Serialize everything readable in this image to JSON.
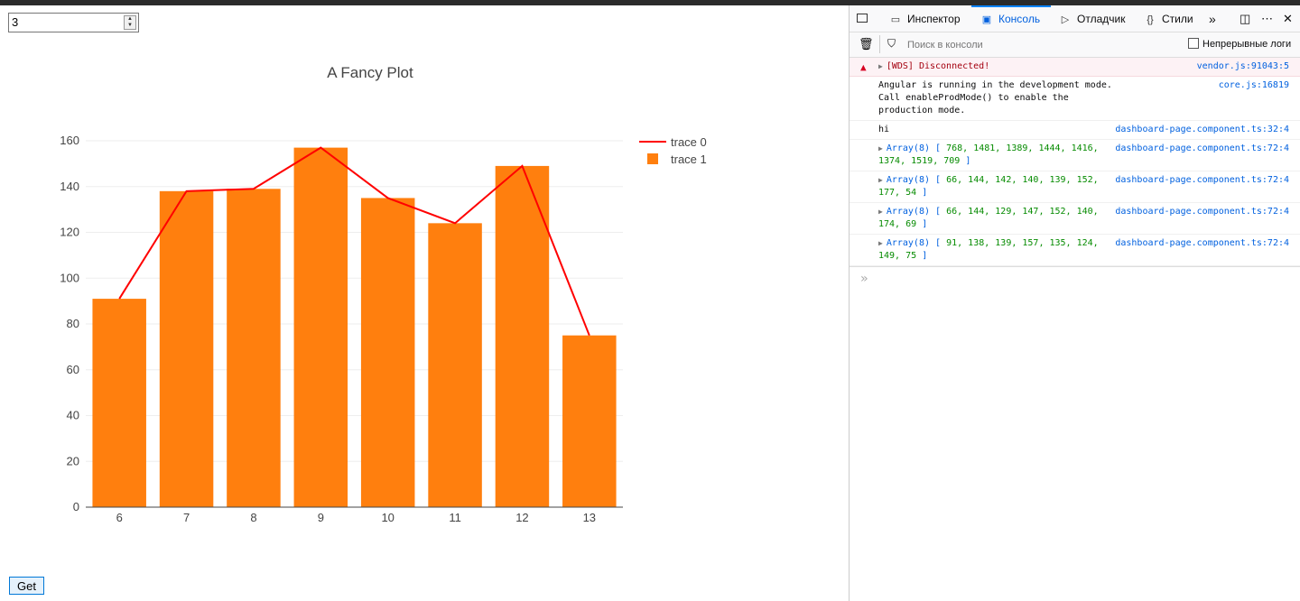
{
  "page": {
    "number_input_value": "3",
    "get_button_label": "Get"
  },
  "chart_data": {
    "type": "bar",
    "title": "A Fancy Plot",
    "x": [
      6,
      7,
      8,
      9,
      10,
      11,
      12,
      13
    ],
    "x_tick_labels": [
      "6",
      "7",
      "8",
      "9",
      "10",
      "11",
      "12",
      "13"
    ],
    "y_tick_labels": [
      "0",
      "20",
      "40",
      "60",
      "80",
      "100",
      "120",
      "140",
      "160"
    ],
    "ylim": [
      0,
      160
    ],
    "grid": true,
    "legend_position": "top-right",
    "series": [
      {
        "name": "trace 0",
        "type": "line",
        "color": "#ff0000",
        "values": [
          91,
          138,
          139,
          157,
          135,
          124,
          149,
          75
        ]
      },
      {
        "name": "trace 1",
        "type": "bar",
        "color": "#ff7f0e",
        "values": [
          91,
          138,
          139,
          157,
          135,
          124,
          149,
          75
        ]
      }
    ]
  },
  "devtools": {
    "tabs": [
      {
        "label": "Инспектор",
        "icon": "inspector-icon"
      },
      {
        "label": "Консоль",
        "icon": "console-icon",
        "active": true
      },
      {
        "label": "Отладчик",
        "icon": "debugger-icon"
      },
      {
        "label": "Стили",
        "icon": "style-editor-icon"
      }
    ],
    "filter_placeholder": "Поиск в консоли",
    "persist_logs_label": "Непрерывные логи",
    "messages": [
      {
        "type": "error",
        "text": "[WDS] Disconnected!",
        "source": "vendor.js:91043:5"
      },
      {
        "type": "log",
        "text": "Angular is running in the development mode. Call enableProdMode() to enable the production mode.",
        "source": "core.js:16819"
      },
      {
        "type": "log",
        "text": "hi",
        "source": "dashboard-page.component.ts:32:4"
      },
      {
        "type": "array",
        "label": "Array(8)",
        "values": "768, 1481, 1389, 1444, 1416, 1374, 1519, 709",
        "source": "dashboard-page.component.ts:72:4"
      },
      {
        "type": "array",
        "label": "Array(8)",
        "values": "66, 144, 142, 140, 139, 152, 177, 54",
        "source": "dashboard-page.component.ts:72:4"
      },
      {
        "type": "array",
        "label": "Array(8)",
        "values": "66, 144, 129, 147, 152, 140, 174, 69",
        "source": "dashboard-page.component.ts:72:4"
      },
      {
        "type": "array",
        "label": "Array(8)",
        "values": "91, 138, 139, 157, 135, 124, 149, 75",
        "source": "dashboard-page.component.ts:72:4"
      }
    ],
    "prompt_symbol": "»"
  }
}
